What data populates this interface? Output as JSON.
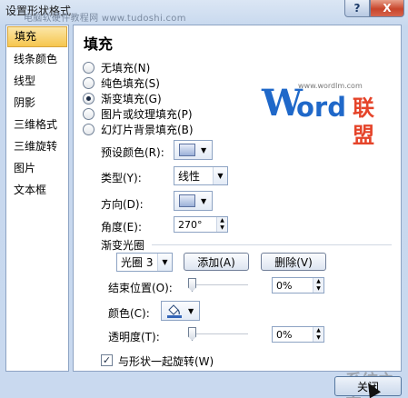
{
  "window": {
    "title": "设置形状格式",
    "watermark_top": "电脑软硬件教程网 www.tudoshi.com",
    "help_label": "?",
    "close_label": "X"
  },
  "sidebar": {
    "items": [
      {
        "label": "填充",
        "selected": true
      },
      {
        "label": "线条颜色"
      },
      {
        "label": "线型"
      },
      {
        "label": "阴影"
      },
      {
        "label": "三维格式"
      },
      {
        "label": "三维旋转"
      },
      {
        "label": "图片"
      },
      {
        "label": "文本框"
      }
    ]
  },
  "panel": {
    "title": "填充",
    "fill_options": [
      {
        "label": "无填充(N)",
        "checked": false
      },
      {
        "label": "纯色填充(S)",
        "checked": false
      },
      {
        "label": "渐变填充(G)",
        "checked": true
      },
      {
        "label": "图片或纹理填充(P)",
        "checked": false
      },
      {
        "label": "幻灯片背景填充(B)",
        "checked": false
      }
    ],
    "logo": {
      "brand_w": "W",
      "brand_ord": "ord",
      "brand_cn": "联盟",
      "url": "www.wordlm.com"
    },
    "preset_colors_label": "预设颜色(R):",
    "type_label": "类型(Y):",
    "type_value": "线性",
    "direction_label": "方向(D):",
    "angle_label": "角度(E):",
    "angle_value": "270°",
    "gradient_stops_label": "渐变光圈",
    "stop_value": "光圈 3",
    "add_label": "添加(A)",
    "delete_label": "删除(V)",
    "end_position_label": "结束位置(O):",
    "end_position_value": "0%",
    "color_label": "颜色(C):",
    "transparency_label": "透明度(T):",
    "transparency_value": "0%",
    "rotate_with_shape_label": "与形状一起旋转(W)",
    "rotate_with_shape_checked": true
  },
  "footer": {
    "close_label": "关闭",
    "watermark": "系统之家"
  },
  "colors": {
    "window_bg": "#c9d9ef",
    "selected_item": "#f6c64e",
    "logo_blue": "#1f68c9",
    "logo_red": "#e5442a"
  }
}
